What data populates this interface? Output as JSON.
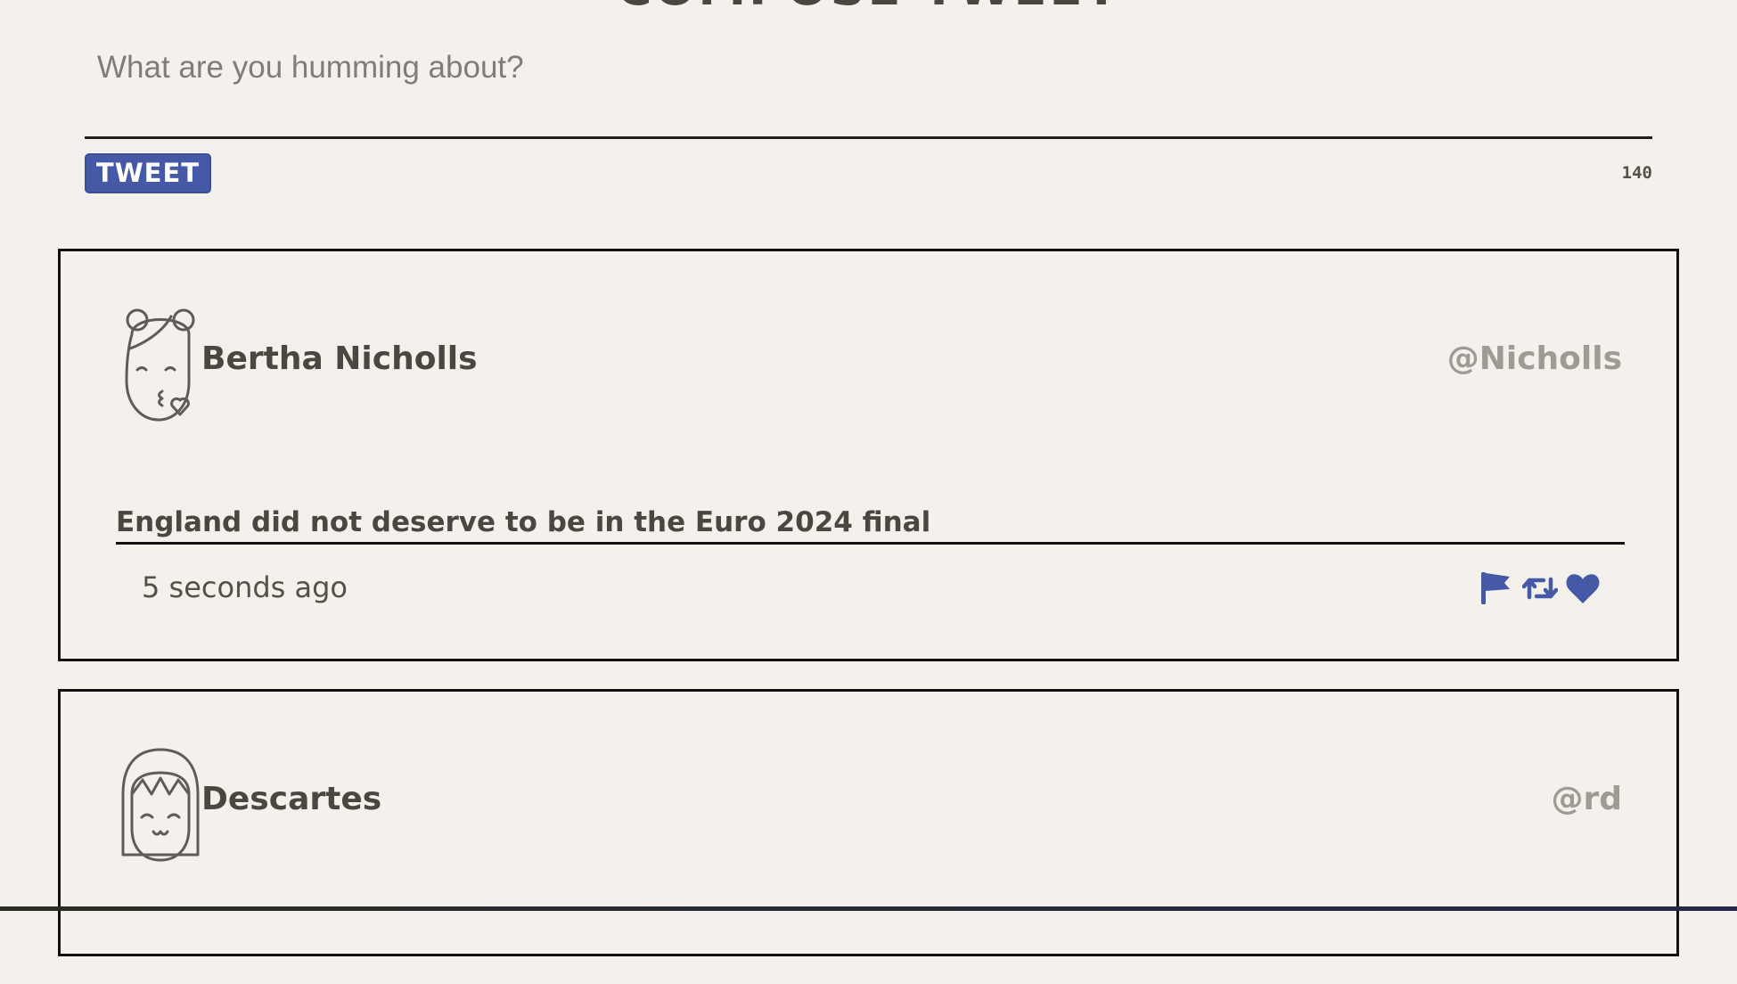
{
  "compose": {
    "heading": "COMPOSE TWEET",
    "placeholder": "What are you humming about?",
    "tweet_button_label": "TWEET",
    "char_counter": "140"
  },
  "tweets": [
    {
      "author_name": "Bertha Nicholls",
      "handle": "@Nicholls",
      "avatar_icon": "girl-blowing-kiss-avatar-icon",
      "text": "England did not deserve to be in the Euro 2024 final",
      "timestamp": "5 seconds ago",
      "actions": [
        "flag-icon",
        "retweet-icon",
        "heart-icon"
      ]
    },
    {
      "author_name": "Descartes",
      "handle": "@rd",
      "avatar_icon": "girl-with-bangs-avatar-icon"
    }
  ],
  "colors": {
    "background": "#f4f1ec",
    "accent": "#4659a7",
    "text": "#4a4741",
    "handle": "#9e9b95"
  }
}
